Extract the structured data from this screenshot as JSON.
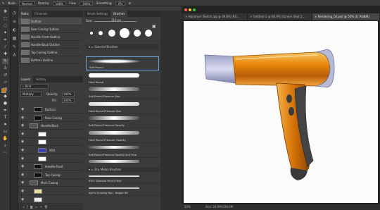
{
  "options_bar": {
    "mode_label": "Mode:",
    "mode_value": "Normal",
    "opacity_label": "Opacity:",
    "opacity_value": "100%",
    "flow_label": "Flow:",
    "flow_value": "100%",
    "smoothing_label": "Smoothing:",
    "smoothing_value": "0%"
  },
  "paths_panel": {
    "tabs": [
      "Paths",
      "Channels"
    ],
    "items": [
      "Outline",
      "Rear-Casing Outline",
      "Handle-Front Outline",
      "Handle-Back Outline",
      "Top Casing Outline",
      "Buttons Outline"
    ]
  },
  "layers_panel": {
    "tabs": [
      "Layers",
      "History"
    ],
    "kind_label": "Kind",
    "blend_mode": "Multiply",
    "opacity_label": "Opacity:",
    "opacity_value": "100%",
    "fill_label": "Fill:",
    "fill_value": "100%",
    "layers": [
      "Buttons",
      "Rear Casing",
      "Handle-Back",
      "",
      "",
      "XXX",
      "",
      "Handle-Front",
      "Top Casing",
      "Main Casing",
      "",
      ""
    ]
  },
  "brushes_panel": {
    "tabs": [
      "Brush Settings",
      "Brushes"
    ],
    "size_label": "Size:",
    "size_value": "112 px",
    "groups": [
      "General Brushes",
      "Dry Media Brushes"
    ],
    "brushes": [
      "Soft Round",
      "Hard Round",
      "Soft Round Pressure Size",
      "Hard Round Pressure Size",
      "Soft Round Pressure Opacity",
      "Hard Round Pressure Opacity",
      "Soft Round Pressure Opacity and Flow",
      "Hard Round Pressure Opacity and Flow"
    ],
    "dry_brushes": [
      "KYLE Ultimate Pencil Hard",
      "Kyle's Drawing Box - Nappa HB"
    ]
  },
  "document": {
    "tabs": [
      "Hairdryer Sketch.jpg @ 49.8% (RG...",
      "Untitled-1 @ 66.9% (Screen Shot 2...",
      "Rendering_03.psd @ 50% (0, RGB/8)"
    ],
    "zoom": "50%",
    "doc_size": "Doc: 24.9M/338.0M"
  },
  "colors": {
    "accent": "#e9890c",
    "casing_dark": "#3a3a3a"
  }
}
